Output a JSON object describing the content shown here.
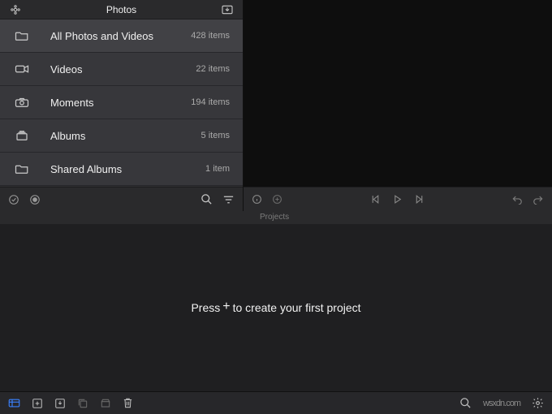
{
  "header": {
    "title": "Photos"
  },
  "sidebar": {
    "items": [
      {
        "label": "All Photos and Videos",
        "count": "428 items",
        "icon": "folder"
      },
      {
        "label": "Videos",
        "count": "22 items",
        "icon": "video"
      },
      {
        "label": "Moments",
        "count": "194 items",
        "icon": "camera"
      },
      {
        "label": "Albums",
        "count": "5 items",
        "icon": "stack"
      },
      {
        "label": "Shared Albums",
        "count": "1 item",
        "icon": "folder"
      }
    ]
  },
  "projects": {
    "section_label": "Projects",
    "empty_prefix": "Press",
    "empty_plus": "+",
    "empty_suffix": "to create your first project"
  },
  "watermark": "wsxdn.com"
}
